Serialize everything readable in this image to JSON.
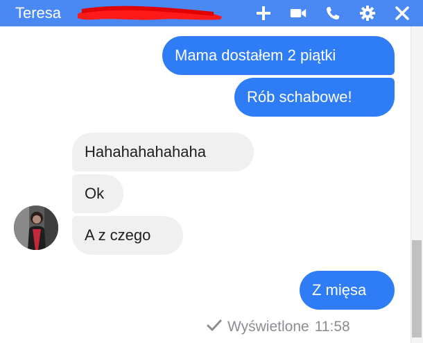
{
  "header": {
    "contact_name": "Teresa",
    "background_color": "#4a89f3",
    "icons": [
      "plus-icon",
      "video-camera-icon",
      "phone-icon",
      "gear-icon",
      "close-icon"
    ]
  },
  "messages": [
    {
      "direction": "outgoing",
      "text": "Mama dostałem 2 piątki"
    },
    {
      "direction": "outgoing",
      "text": "Rób schabowe!"
    },
    {
      "direction": "incoming",
      "text": "Hahahahahahaha"
    },
    {
      "direction": "incoming",
      "text": "Ok"
    },
    {
      "direction": "incoming",
      "text": "A z czego"
    },
    {
      "direction": "outgoing",
      "text": "Z mięsa"
    }
  ],
  "status": {
    "seen_label": "Wyświetlone",
    "time": "11:58"
  },
  "colors": {
    "outgoing_bubble": "#2f7df6",
    "incoming_bubble": "#f1f0f0",
    "redaction": "#ff1a1a"
  }
}
